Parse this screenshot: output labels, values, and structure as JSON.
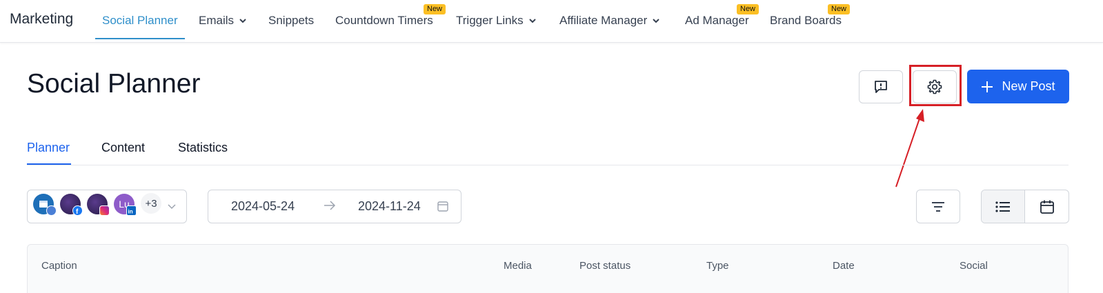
{
  "nav": {
    "brand": "Marketing",
    "items": [
      {
        "label": "Social Planner",
        "active": true,
        "dropdown": false,
        "badge": ""
      },
      {
        "label": "Emails",
        "active": false,
        "dropdown": true,
        "badge": ""
      },
      {
        "label": "Snippets",
        "active": false,
        "dropdown": false,
        "badge": ""
      },
      {
        "label": "Countdown Timers",
        "active": false,
        "dropdown": false,
        "badge": "New"
      },
      {
        "label": "Trigger Links",
        "active": false,
        "dropdown": true,
        "badge": ""
      },
      {
        "label": "Affiliate Manager",
        "active": false,
        "dropdown": true,
        "badge": ""
      },
      {
        "label": "Ad Manager",
        "active": false,
        "dropdown": false,
        "badge": "New"
      },
      {
        "label": "Brand Boards",
        "active": false,
        "dropdown": false,
        "badge": "New"
      }
    ]
  },
  "header": {
    "title": "Social Planner",
    "feedback_icon": "message-alert-icon",
    "settings_icon": "gear-icon",
    "new_post_label": "New Post"
  },
  "tabs": [
    {
      "label": "Planner",
      "active": true
    },
    {
      "label": "Content",
      "active": false
    },
    {
      "label": "Statistics",
      "active": false
    }
  ],
  "accounts": {
    "avatars": [
      {
        "initials": "",
        "network": "google-business-icon",
        "color": "#1e6fb8"
      },
      {
        "initials": "",
        "network": "facebook-icon",
        "color": "#3b2a6b"
      },
      {
        "initials": "",
        "network": "instagram-icon",
        "color": "#3b2a6b"
      },
      {
        "initials": "Lu",
        "network": "linkedin-icon",
        "color": "#8e5cc9"
      }
    ],
    "more_count": "+3"
  },
  "date_range": {
    "start": "2024-05-24",
    "end": "2024-11-24"
  },
  "table": {
    "columns": [
      "Caption",
      "Media",
      "Post status",
      "Type",
      "Date",
      "Social"
    ]
  },
  "colors": {
    "accent": "#1d63ed",
    "nav_active": "#2f8fca",
    "badge": "#fbbf24",
    "annotation": "#d61f26"
  }
}
